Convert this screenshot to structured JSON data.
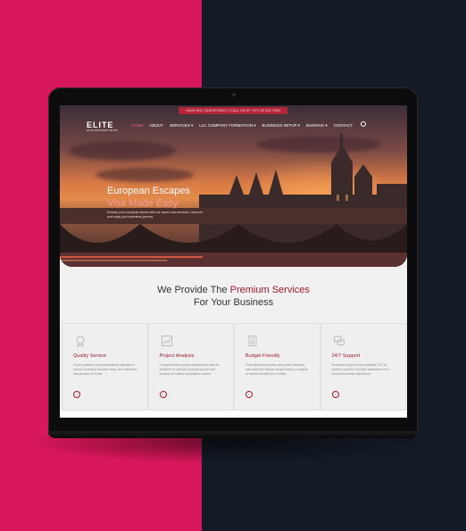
{
  "colors": {
    "left_bg": "#d8165b",
    "right_bg": "#141b27",
    "accent": "#9a1b2d"
  },
  "topbar": {
    "text": "HAVE ANY QUESTIONS? | CALL US AT +971 50 522 7050"
  },
  "logo": {
    "name": "ELITE",
    "tagline": "ELITE BUSINESS SETUP"
  },
  "nav": {
    "items": [
      "HOME",
      "ABOUT",
      "SERVICES ▾",
      "LLC COMPANY FORMATION ▾",
      "BUSINESS SETUP ▾",
      "BANKING ▾",
      "CONTACT"
    ]
  },
  "hero": {
    "title_line1": "European Escapes",
    "title_line2": "Visa Made Easy",
    "subtitle": "Embark your european dream with our expert visa services. Discover and enjoy your seamless journey"
  },
  "section": {
    "title_prefix": "We Provide The ",
    "title_highlight": "Premium Services",
    "title_line2": "For Your Business"
  },
  "cards": [
    {
      "icon": "medal-icon",
      "title": "Quality Service",
      "text": "Expert guidance and personalized attention to ensure seamless business setup and residency visa process in Dubai."
    },
    {
      "icon": "analysis-icon",
      "title": "Project Analysis",
      "text": "Comprehensive project analysis and tailored solutions to optimize business growth and success in Dubai's competitive market."
    },
    {
      "icon": "budget-icon",
      "title": "Budget Friendly",
      "text": "Cost-effective business setup and residency visa solutions without compromising on quality or service excellence in Dubai."
    },
    {
      "icon": "support-icon",
      "title": "24/7 Support",
      "text": "Dedicated support team available 24/7 to address queries & provide assistance for a smooth customer experience."
    }
  ]
}
